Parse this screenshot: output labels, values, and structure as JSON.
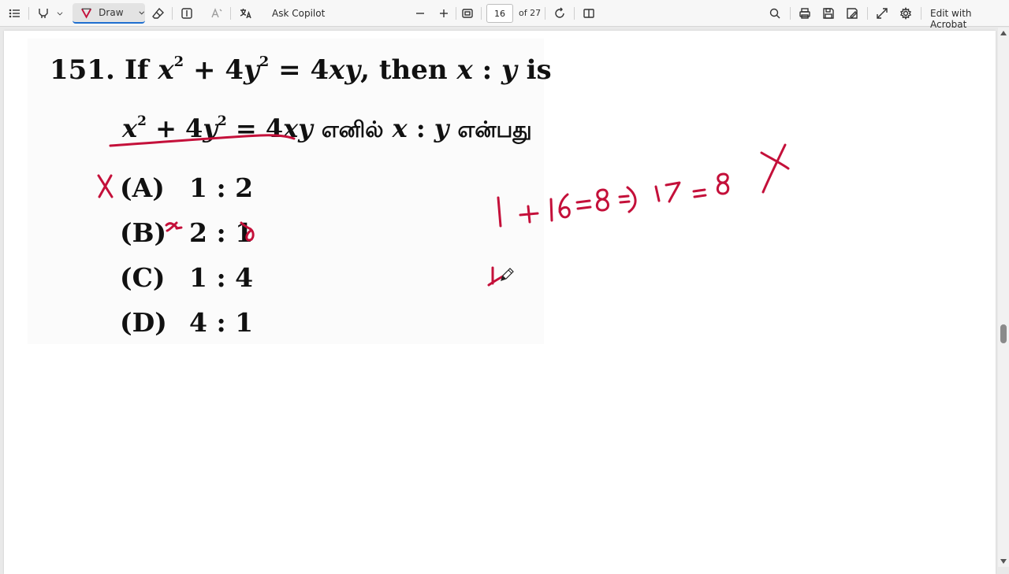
{
  "toolbar": {
    "draw_label": "Draw",
    "ask_copilot_label": "Ask Copilot",
    "page_current": "16",
    "page_total": "of 27",
    "edit_acrobat_label": "Edit with Acrobat",
    "icons": [
      "contents-icon",
      "highlight-icon",
      "chevron-down-icon",
      "draw-icon",
      "eraser-icon",
      "text-box-icon",
      "read-aloud-icon",
      "translate-icon",
      "zoom-out-icon",
      "zoom-in-icon",
      "fit-page-icon",
      "rotate-icon",
      "page-view-icon",
      "search-icon",
      "print-icon",
      "save-icon",
      "save-as-icon",
      "fullscreen-icon",
      "settings-icon"
    ],
    "accent": "#1f6fd0"
  },
  "document": {
    "question_number": "151.",
    "question_prefix": "If",
    "question_x": "x",
    "question_plus": "+ 4",
    "question_y": "y",
    "question_eq": "= 4",
    "question_xy": "xy",
    "question_then": ", then",
    "question_ratio_x": "x",
    "question_colon": ":",
    "question_ratio_y": "y",
    "question_is": "is",
    "sup_2": "2",
    "tamil_enil": "எனில்",
    "tamil_enbathu": "என்பது",
    "options": [
      {
        "label": "(A)",
        "value": "1 : 2"
      },
      {
        "label": "(B)",
        "value": "2 : 1"
      },
      {
        "label": "(C)",
        "value": "1 : 4"
      },
      {
        "label": "(D)",
        "value": "4 : 1"
      }
    ]
  },
  "annotations": {
    "ink_color": "#c4103a"
  }
}
